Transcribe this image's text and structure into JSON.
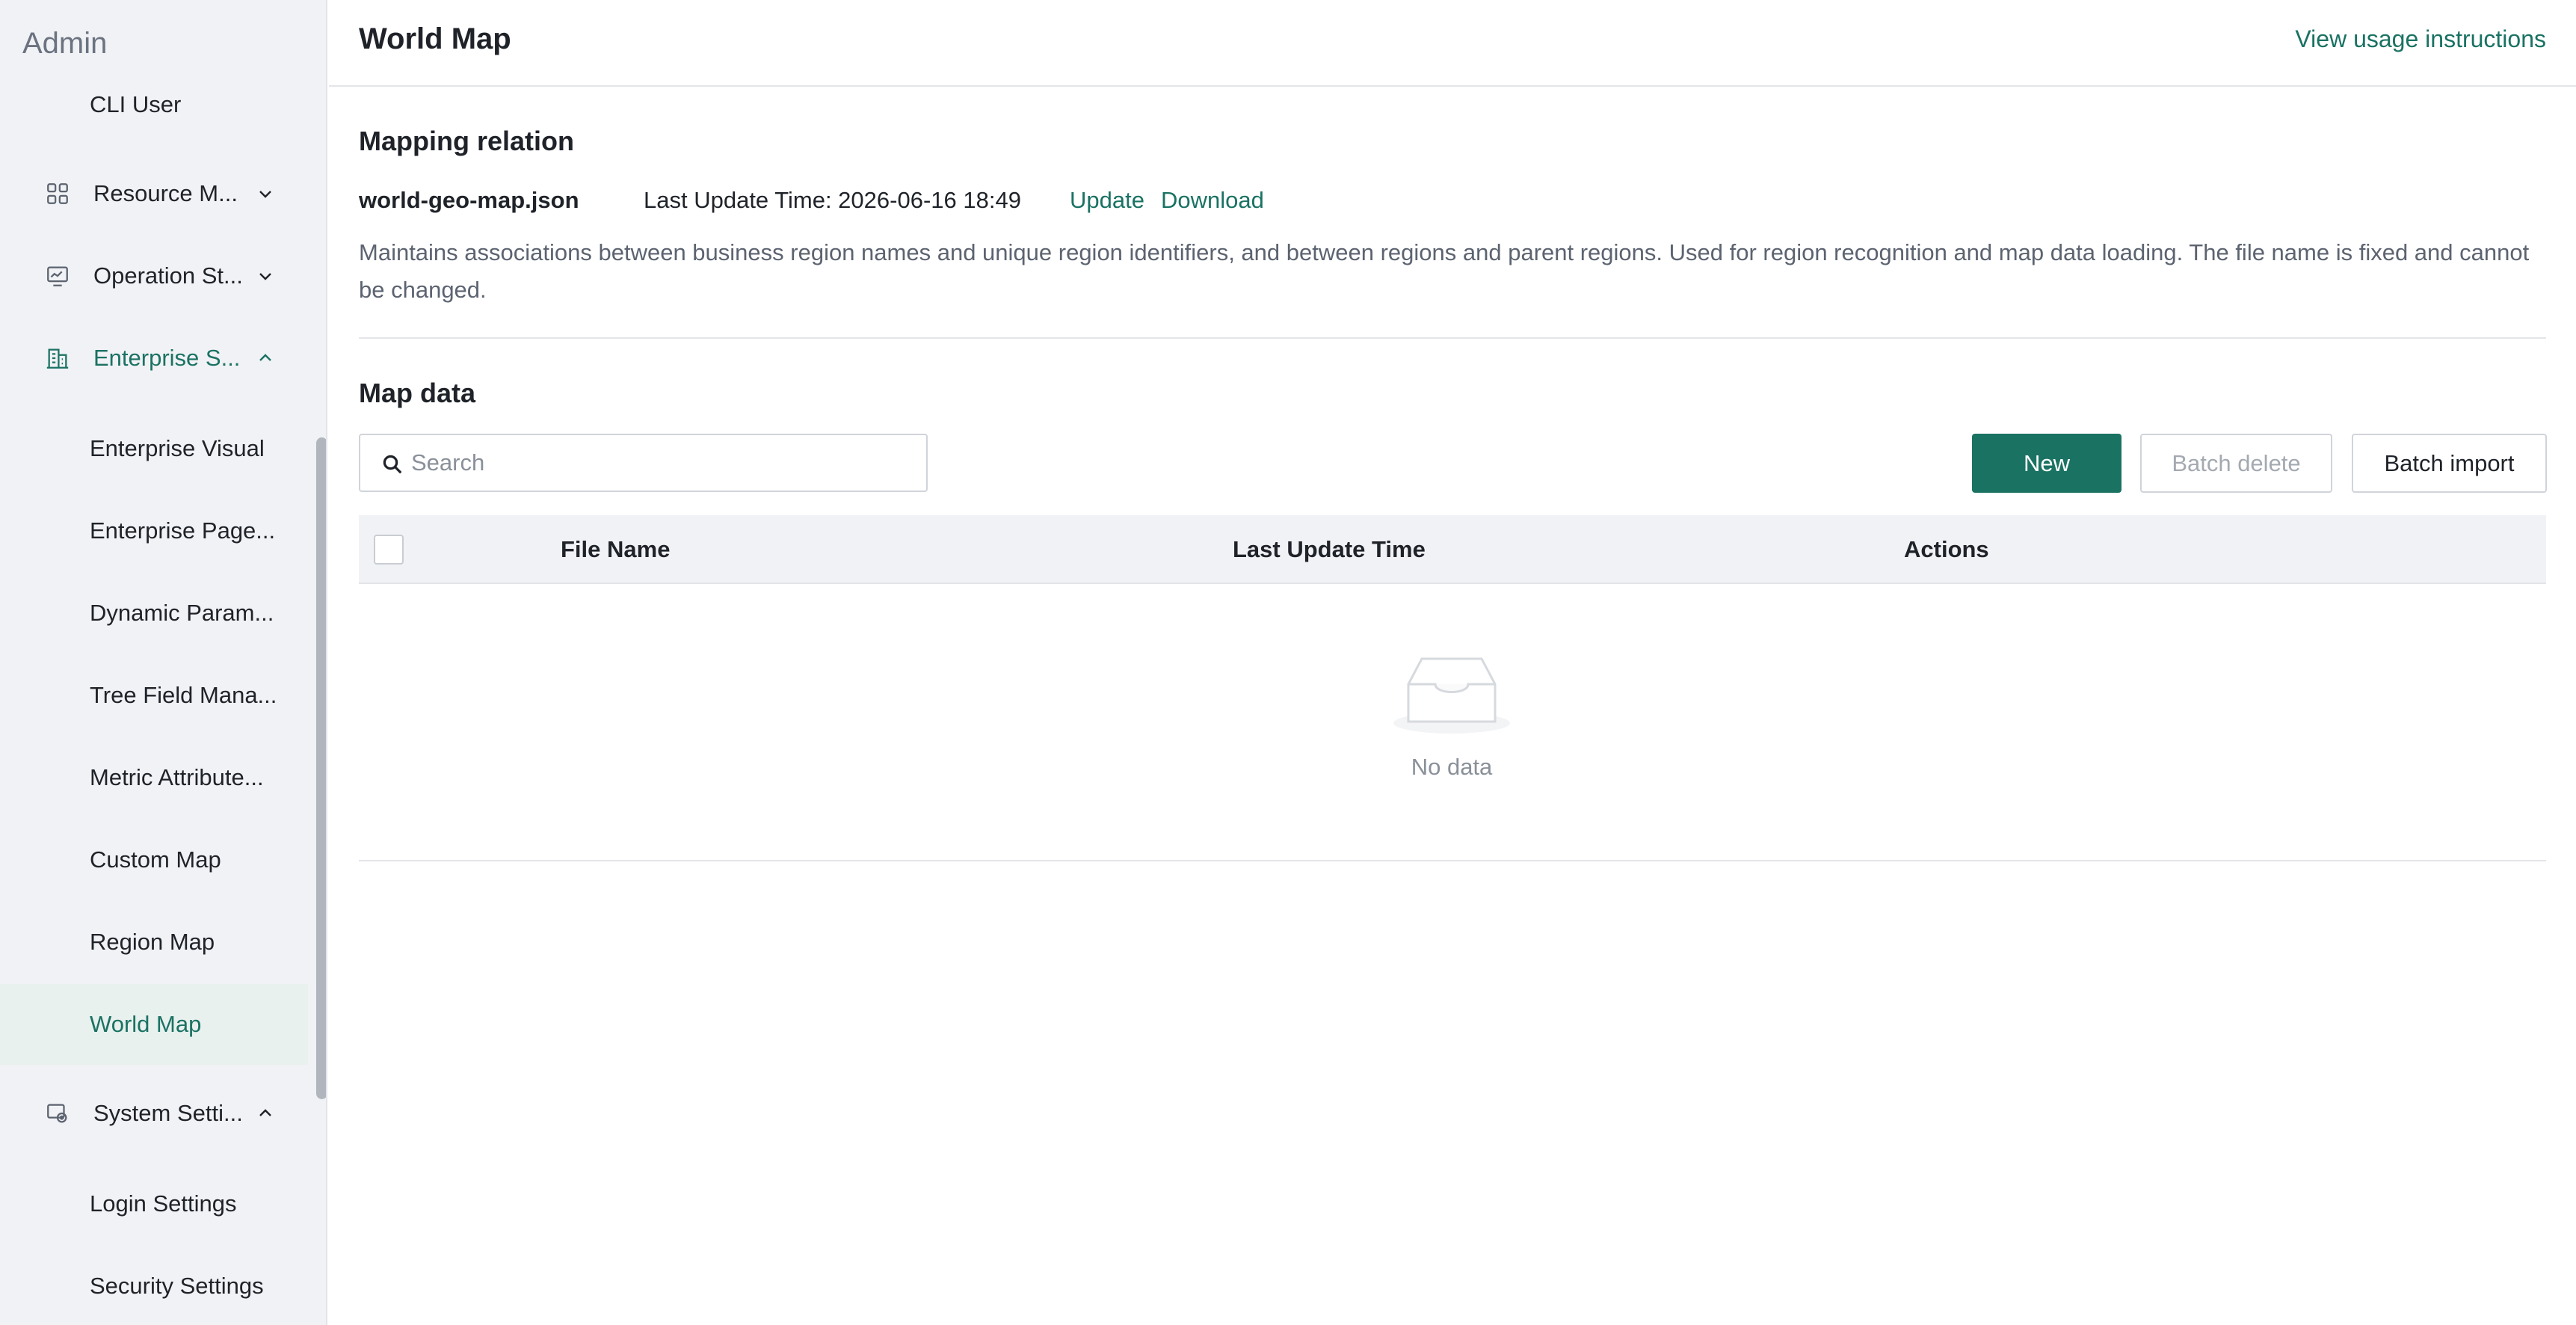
{
  "sidebar": {
    "title": "Admin",
    "cli_user": "CLI User",
    "groups": [
      {
        "label": "Resource M...",
        "icon": "grid-icon",
        "expanded": false
      },
      {
        "label": "Operation St...",
        "icon": "monitor-icon",
        "expanded": false
      },
      {
        "label": "Enterprise S...",
        "icon": "building-icon",
        "expanded": true
      },
      {
        "label": "System Setti...",
        "icon": "settings-icon",
        "expanded": true
      }
    ],
    "enterprise_items": [
      "Enterprise Visual",
      "Enterprise Page...",
      "Dynamic Param...",
      "Tree Field Mana...",
      "Metric Attribute...",
      "Custom Map",
      "Region Map",
      "World Map"
    ],
    "system_items": [
      "Login Settings",
      "Security Settings"
    ],
    "active_item": "World Map"
  },
  "header": {
    "title": "World Map",
    "usage_link": "View usage instructions"
  },
  "mapping": {
    "section_title": "Mapping relation",
    "file_name": "world-geo-map.json",
    "update_time": "Last Update Time: 2026-06-16 18:49",
    "update_link": "Update",
    "download_link": "Download",
    "description": "Maintains associations between business region names and unique region identifiers, and between regions and parent regions. Used for region recognition and map data loading. The file name is fixed and cannot be changed."
  },
  "map_data": {
    "section_title": "Map data",
    "search_placeholder": "Search",
    "new_button": "New",
    "batch_delete_button": "Batch delete",
    "batch_import_button": "Batch import",
    "columns": [
      "File Name",
      "Last Update Time",
      "Actions"
    ],
    "rows": [],
    "empty_text": "No data"
  },
  "colors": {
    "accent": "#1a7263",
    "sidebar_bg": "#f1f2f5",
    "active_bg": "#e8f1ee"
  }
}
